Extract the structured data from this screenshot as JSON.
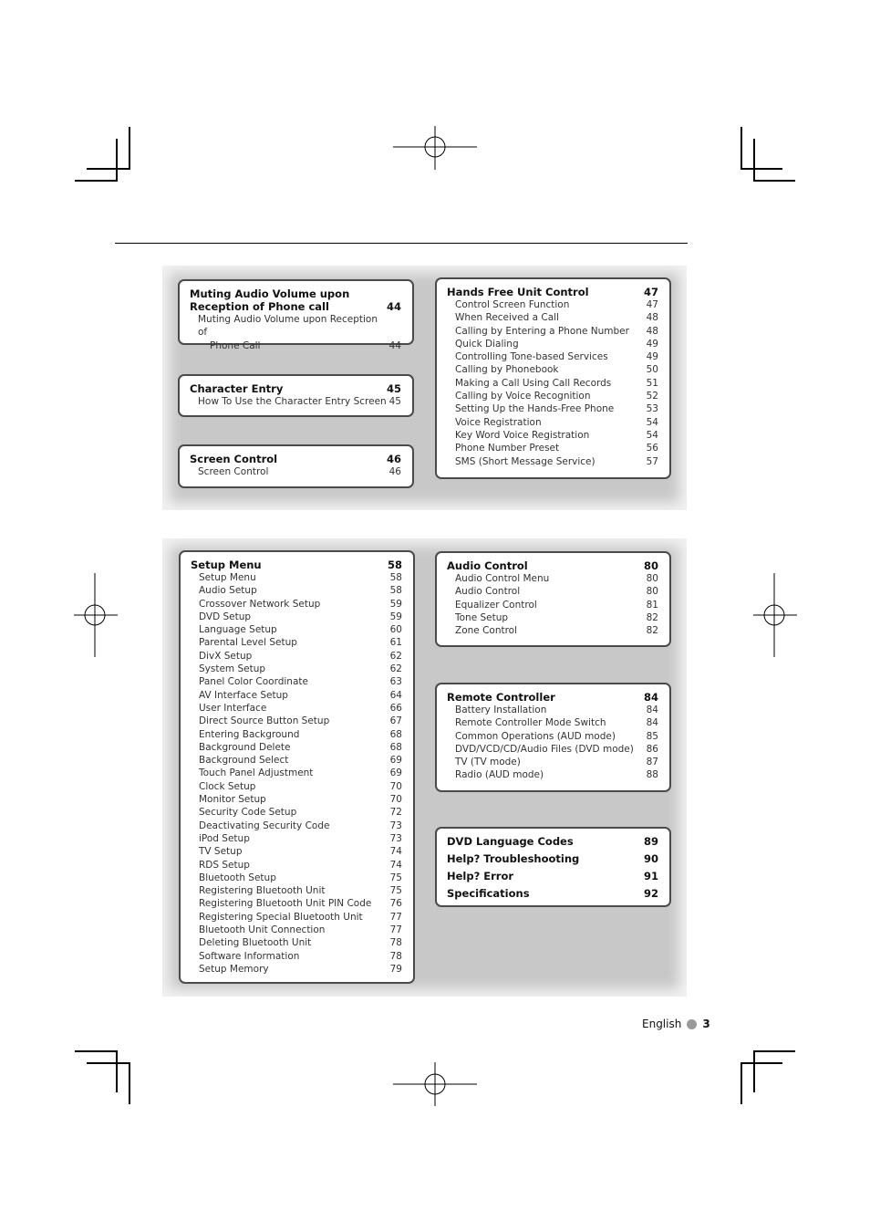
{
  "sections": {
    "muting": {
      "title": "Muting Audio Volume upon Reception of Phone call",
      "page": "44",
      "items": [
        {
          "label_line1": "Muting Audio Volume upon Reception of",
          "label_line2": "Phone Call",
          "page": "44"
        }
      ]
    },
    "character_entry": {
      "title": "Character Entry",
      "page": "45",
      "items": [
        {
          "label": "How To Use the Character Entry Screen",
          "page": "45"
        }
      ]
    },
    "screen_control": {
      "title": "Screen Control",
      "page": "46",
      "items": [
        {
          "label": "Screen Control",
          "page": "46"
        }
      ]
    },
    "hands_free": {
      "title": "Hands Free Unit Control",
      "page": "47",
      "items": [
        {
          "label": "Control Screen Function",
          "page": "47"
        },
        {
          "label": "When Received a Call",
          "page": "48"
        },
        {
          "label": "Calling by Entering a Phone Number",
          "page": "48"
        },
        {
          "label": "Quick Dialing",
          "page": "49"
        },
        {
          "label": "Controlling Tone-based Services",
          "page": "49"
        },
        {
          "label": "Calling by Phonebook",
          "page": "50"
        },
        {
          "label": "Making a Call Using Call Records",
          "page": "51"
        },
        {
          "label": "Calling by Voice Recognition",
          "page": "52"
        },
        {
          "label": "Setting Up the Hands-Free Phone",
          "page": "53"
        },
        {
          "label": "Voice Registration",
          "page": "54"
        },
        {
          "label": "Key Word Voice Registration",
          "page": "54"
        },
        {
          "label": "Phone Number Preset",
          "page": "56"
        },
        {
          "label": "SMS (Short Message Service)",
          "page": "57"
        }
      ]
    },
    "setup_menu": {
      "title": "Setup Menu",
      "page": "58",
      "items": [
        {
          "label": "Setup Menu",
          "page": "58"
        },
        {
          "label": "Audio Setup",
          "page": "58"
        },
        {
          "label": "Crossover Network Setup",
          "page": "59"
        },
        {
          "label": "DVD Setup",
          "page": "59"
        },
        {
          "label": "Language Setup",
          "page": "60"
        },
        {
          "label": "Parental Level Setup",
          "page": "61"
        },
        {
          "label": "DivX Setup",
          "page": "62"
        },
        {
          "label": "System Setup",
          "page": "62"
        },
        {
          "label": "Panel Color Coordinate",
          "page": "63"
        },
        {
          "label": "AV Interface Setup",
          "page": "64"
        },
        {
          "label": "User Interface",
          "page": "66"
        },
        {
          "label": "Direct Source Button Setup",
          "page": "67"
        },
        {
          "label": "Entering Background",
          "page": "68"
        },
        {
          "label": "Background Delete",
          "page": "68"
        },
        {
          "label": "Background Select",
          "page": "69"
        },
        {
          "label": "Touch Panel Adjustment",
          "page": "69"
        },
        {
          "label": "Clock Setup",
          "page": "70"
        },
        {
          "label": "Monitor Setup",
          "page": "70"
        },
        {
          "label": "Security Code Setup",
          "page": "72"
        },
        {
          "label": "Deactivating Security Code",
          "page": "73"
        },
        {
          "label": "iPod Setup",
          "page": "73"
        },
        {
          "label": "TV Setup",
          "page": "74"
        },
        {
          "label": "RDS Setup",
          "page": "74"
        },
        {
          "label": "Bluetooth Setup",
          "page": "75"
        },
        {
          "label": "Registering Bluetooth Unit",
          "page": "75"
        },
        {
          "label": "Registering Bluetooth Unit PIN Code",
          "page": "76"
        },
        {
          "label": "Registering Special Bluetooth Unit",
          "page": "77"
        },
        {
          "label": "Bluetooth Unit Connection",
          "page": "77"
        },
        {
          "label": "Deleting Bluetooth Unit",
          "page": "78"
        },
        {
          "label": "Software Information",
          "page": "78"
        },
        {
          "label": "Setup Memory",
          "page": "79"
        }
      ]
    },
    "audio_control": {
      "title": "Audio Control",
      "page": "80",
      "items": [
        {
          "label": "Audio Control Menu",
          "page": "80"
        },
        {
          "label": "Audio Control",
          "page": "80"
        },
        {
          "label": "Equalizer Control",
          "page": "81"
        },
        {
          "label": "Tone Setup",
          "page": "82"
        },
        {
          "label": "Zone Control",
          "page": "82"
        }
      ]
    },
    "remote_controller": {
      "title": "Remote Controller",
      "page": "84",
      "items": [
        {
          "label": "Battery Installation",
          "page": "84"
        },
        {
          "label": "Remote Controller Mode Switch",
          "page": "84"
        },
        {
          "label": "Common Operations (AUD mode)",
          "page": "85"
        },
        {
          "label": "DVD/VCD/CD/Audio Files (DVD mode)",
          "page": "86"
        },
        {
          "label": "TV (TV mode)",
          "page": "87"
        },
        {
          "label": "Radio (AUD mode)",
          "page": "88"
        }
      ]
    },
    "appendix": {
      "items": [
        {
          "label": "DVD Language Codes",
          "page": "89"
        },
        {
          "label": "Help? Troubleshooting",
          "page": "90"
        },
        {
          "label": "Help? Error",
          "page": "91"
        },
        {
          "label": "Specifications",
          "page": "92"
        }
      ]
    }
  },
  "footer": {
    "language": "English",
    "page_number": "3",
    "bullet_color": "#9a9a9a"
  },
  "colors": {
    "panel_background": "#c8c8c8",
    "box_border": "#4a4a4a"
  }
}
